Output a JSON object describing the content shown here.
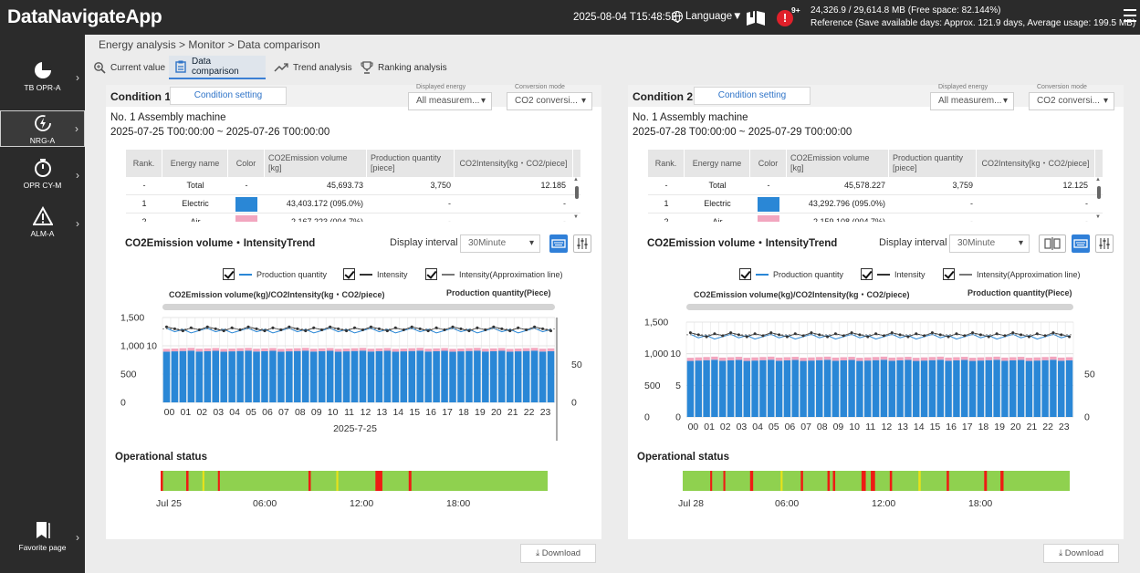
{
  "app": {
    "title": "DataNavigateApp"
  },
  "header": {
    "datetime": "2025-08-04 T15:48:52",
    "language_label": "Language▼",
    "alert_count": "9+",
    "alert_glyph": "!",
    "memory_line1": "24,326.9 / 29,614.8 MB (Free space: 82.144%)",
    "memory_line2": "Reference (Save available days: Approx. 121.9 days, Average usage: 199.5 MB)"
  },
  "sidebar": {
    "items": [
      {
        "label": "TB OPR-A",
        "icon": "pie-chart-icon"
      },
      {
        "label": "NRG-A",
        "icon": "energy-icon"
      },
      {
        "label": "OPR CY-M",
        "icon": "stopwatch-icon"
      },
      {
        "label": "ALM-A",
        "icon": "warning-icon"
      }
    ],
    "favorite_label": "Favorite page"
  },
  "breadcrumb": "Energy analysis > Monitor > Data comparison",
  "tabs": [
    {
      "label": "Current value",
      "icon": "magnifier-icon"
    },
    {
      "label": "Data comparison",
      "icon": "clipboard-icon"
    },
    {
      "label": "Trend analysis",
      "icon": "trend-icon"
    },
    {
      "label": "Ranking analysis",
      "icon": "trophy-icon"
    }
  ],
  "shared": {
    "condition_setting": "Condition setting",
    "displayed_energy_label": "Displayed energy",
    "displayed_energy_value": "All measurem...",
    "conversion_mode_label": "Conversion mode",
    "conversion_mode_value": "CO2 conversi...",
    "table_headers": [
      "Rank.",
      "Energy name",
      "Color",
      "CO2Emission volume\n[kg]",
      "Production quantity\n[piece]",
      "CO2Intensity[kg・CO2/piece]"
    ],
    "trend_title": "CO2Emission volume・IntensityTrend",
    "display_interval_label": "Display interval",
    "display_interval_value": "30Minute",
    "legend": [
      "Production quantity",
      "Intensity",
      "Intensity(Approximation line)"
    ],
    "left_axis_title": "CO2Emission volume(kg)/CO2Intensity(kg・CO2/piece)",
    "right_axis_title": "Production quantity(Piece)",
    "operational_status": "Operational status",
    "download": "Download",
    "colors": {
      "electric": "#2a87d6",
      "second_energy": "#f2a6bf",
      "running": "#8fd14f",
      "stopped": "#ee1b14",
      "idle": "#e8e21a",
      "accent": "#2f74c8"
    }
  },
  "conditions": [
    {
      "title": "Condition 1",
      "machine": "No. 1 Assembly machine",
      "range": "2025-07-25 T00:00:00 ~ 2025-07-26 T00:00:00",
      "rows": [
        {
          "rank": "-",
          "name": "Total",
          "color": "-",
          "co2": "45,693.73",
          "qty": "3,750",
          "intensity": "12.185"
        },
        {
          "rank": "1",
          "name": "Electric",
          "color": "electric",
          "co2": "43,403.172 (095.0%)",
          "qty": "-",
          "intensity": "-"
        },
        {
          "rank": "2",
          "name": "Air",
          "color": "second_energy",
          "co2": "2,167,223 (004.7%)",
          "qty": "-",
          "intensity": "-"
        }
      ],
      "op_ticks": [
        "Jul 25",
        "06:00",
        "12:00",
        "18:00"
      ],
      "op_events": [
        {
          "at": 0.0,
          "span": 0.006,
          "state": "stopped"
        },
        {
          "at": 0.066,
          "span": 0.006,
          "state": "stopped"
        },
        {
          "at": 0.108,
          "span": 0.005,
          "state": "idle"
        },
        {
          "at": 0.148,
          "span": 0.005,
          "state": "stopped"
        },
        {
          "at": 0.382,
          "span": 0.006,
          "state": "stopped"
        },
        {
          "at": 0.454,
          "span": 0.005,
          "state": "idle"
        },
        {
          "at": 0.555,
          "span": 0.018,
          "state": "stopped"
        },
        {
          "at": 0.641,
          "span": 0.007,
          "state": "stopped"
        }
      ],
      "chart_data": {
        "type": "bar",
        "title": "CO2Emission volume・IntensityTrend",
        "xlabel": "2025-7-25",
        "ylabel_left": "CO2Emission volume(kg)/CO2Intensity(kg・CO2/piece)",
        "ylabel_right": "Production quantity(Piece)",
        "categories": [
          "00",
          "01",
          "02",
          "03",
          "04",
          "05",
          "06",
          "07",
          "08",
          "09",
          "10",
          "11",
          "12",
          "13",
          "14",
          "15",
          "16",
          "17",
          "18",
          "19",
          "20",
          "21",
          "22",
          "23"
        ],
        "bar_slots": 48,
        "ylim_volume": [
          0,
          1500
        ],
        "yticks_volume": [
          "0",
          "500",
          "1,000",
          "1,500"
        ],
        "yticks_intensity": [
          "10"
        ],
        "yticks_quantity": [
          "0",
          "50"
        ],
        "series": [
          {
            "name": "Electric",
            "color": "electric",
            "values_approx": 905
          },
          {
            "name": "Air",
            "color": "second_energy",
            "values_approx": 50
          },
          {
            "name": "Production quantity",
            "value_approx": 78
          },
          {
            "name": "Intensity",
            "value_approx": 12.2
          }
        ]
      }
    },
    {
      "title": "Condition 2",
      "machine": "No. 1 Assembly machine",
      "range": "2025-07-28 T00:00:00 ~ 2025-07-29 T00:00:00",
      "rows": [
        {
          "rank": "-",
          "name": "Total",
          "color": "-",
          "co2": "45,578.227",
          "qty": "3,759",
          "intensity": "12.125"
        },
        {
          "rank": "1",
          "name": "Electric",
          "color": "electric",
          "co2": "43,292.796 (095.0%)",
          "qty": "-",
          "intensity": "-"
        },
        {
          "rank": "2",
          "name": "Air",
          "color": "second_energy",
          "co2": "2,159,108 (004.7%)",
          "qty": "-",
          "intensity": "-"
        }
      ],
      "op_ticks": [
        "Jul 28",
        "06:00",
        "12:00",
        "18:00"
      ],
      "op_events": [
        {
          "at": 0.071,
          "span": 0.005,
          "state": "stopped"
        },
        {
          "at": 0.105,
          "span": 0.005,
          "state": "stopped"
        },
        {
          "at": 0.174,
          "span": 0.008,
          "state": "stopped"
        },
        {
          "at": 0.253,
          "span": 0.005,
          "state": "idle"
        },
        {
          "at": 0.305,
          "span": 0.006,
          "state": "stopped"
        },
        {
          "at": 0.374,
          "span": 0.006,
          "state": "stopped"
        },
        {
          "at": 0.388,
          "span": 0.006,
          "state": "stopped"
        },
        {
          "at": 0.462,
          "span": 0.011,
          "state": "stopped"
        },
        {
          "at": 0.486,
          "span": 0.011,
          "state": "stopped"
        },
        {
          "at": 0.535,
          "span": 0.006,
          "state": "stopped"
        },
        {
          "at": 0.609,
          "span": 0.006,
          "state": "idle"
        },
        {
          "at": 0.682,
          "span": 0.006,
          "state": "stopped"
        },
        {
          "at": 0.779,
          "span": 0.007,
          "state": "stopped"
        },
        {
          "at": 0.821,
          "span": 0.008,
          "state": "stopped"
        }
      ],
      "chart_data": {
        "type": "bar",
        "title": "CO2Emission volume・IntensityTrend",
        "xlabel": "",
        "ylabel_left": "CO2Emission volume(kg)/CO2Intensity(kg・CO2/piece)",
        "ylabel_right": "Production quantity(Piece)",
        "categories": [
          "00",
          "01",
          "02",
          "03",
          "04",
          "05",
          "06",
          "07",
          "08",
          "09",
          "10",
          "11",
          "12",
          "13",
          "14",
          "15",
          "16",
          "17",
          "18",
          "19",
          "20",
          "21",
          "22",
          "23"
        ],
        "bar_slots": 48,
        "ylim_volume": [
          0,
          1500
        ],
        "yticks_volume": [
          "0",
          "500",
          "1,000",
          "1,500"
        ],
        "yticks_intensity": [
          "0",
          "5",
          "10"
        ],
        "yticks_quantity": [
          "0",
          "50"
        ],
        "series": [
          {
            "name": "Electric",
            "color": "electric",
            "values_approx": 895
          },
          {
            "name": "Air",
            "color": "second_energy",
            "values_approx": 50
          },
          {
            "name": "Production quantity",
            "value_approx": 78
          },
          {
            "name": "Intensity",
            "value_approx": 12.1
          }
        ]
      }
    }
  ]
}
